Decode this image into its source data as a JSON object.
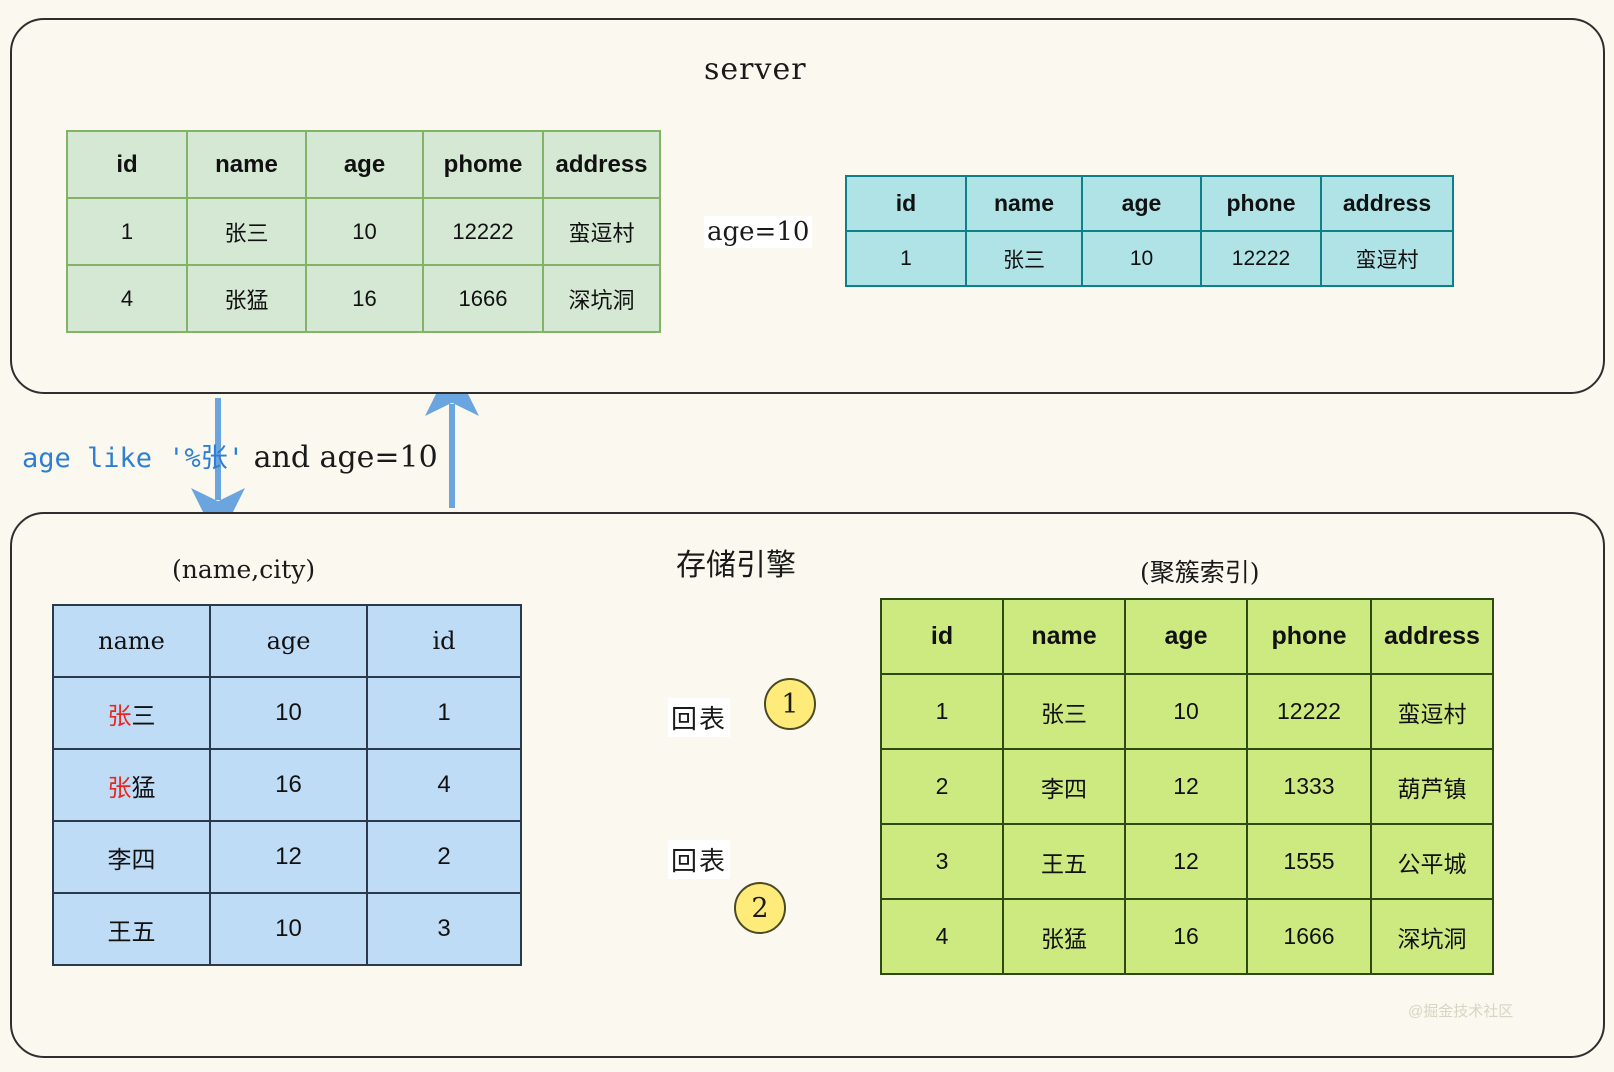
{
  "server": {
    "title": "server",
    "source_table": {
      "columns": [
        "id",
        "name",
        "age",
        "phome",
        "address"
      ],
      "rows": [
        [
          "1",
          "张三",
          "10",
          "12222",
          "蛮逗村"
        ],
        [
          "4",
          "张猛",
          "16",
          "1666",
          "深坑洞"
        ]
      ]
    },
    "result_table": {
      "columns": [
        "id",
        "name",
        "age",
        "phone",
        "address"
      ],
      "rows": [
        [
          "1",
          "张三",
          "10",
          "12222",
          "蛮逗村"
        ]
      ]
    },
    "filter_arrow_label": "age=10"
  },
  "condition": {
    "blue_text": "age like '%张'",
    "black_text": " and age=10"
  },
  "engine": {
    "title": "存储引擎",
    "index_label": "(name,city)",
    "clustered_label": "(聚簇索引)",
    "index_table": {
      "columns": [
        "name",
        "age",
        "id"
      ],
      "rows": [
        {
          "name_red": "张",
          "name_rest": "三",
          "age": "10",
          "id": "1",
          "id_red": true
        },
        {
          "name_red": "张",
          "name_rest": "猛",
          "age": "16",
          "id": "4",
          "id_red": true
        },
        {
          "name_red": "",
          "name_rest": "李四",
          "age": "12",
          "id": "2",
          "id_red": false
        },
        {
          "name_red": "",
          "name_rest": "王五",
          "age": "10",
          "id": "3",
          "id_red": false
        }
      ]
    },
    "clustered_table": {
      "columns": [
        "id",
        "name",
        "age",
        "phone",
        "address"
      ],
      "rows": [
        {
          "id": "1",
          "id_red": true,
          "name": "张三",
          "age": "10",
          "phone": "12222",
          "address": "蛮逗村"
        },
        {
          "id": "2",
          "id_red": false,
          "name": "李四",
          "age": "12",
          "phone": "1333",
          "address": "葫芦镇"
        },
        {
          "id": "3",
          "id_red": false,
          "name": "王五",
          "age": "12",
          "phone": "1555",
          "address": "公平城"
        },
        {
          "id": "4",
          "id_red": true,
          "name": "张猛",
          "age": "16",
          "phone": "1666",
          "address": "深坑洞"
        }
      ]
    },
    "lookup_label_1": "回表",
    "lookup_label_2": "回表",
    "step_1": "1",
    "step_2": "2"
  },
  "watermark": "@掘金技术社区",
  "colors": {
    "background": "#faf8ef",
    "green_fill": "#d5e8d4",
    "green_border": "#82b366",
    "cyan_fill": "#b0e3e6",
    "cyan_border": "#0e8088",
    "blue_fill": "#bfdcf7",
    "blue_border": "#2a3a4a",
    "bright_green_fill": "#cdea81",
    "bright_green_border": "#2d4a12",
    "arrow_blue": "#6ba5e0",
    "highlight_red": "#e8281e",
    "circle_yellow": "#ffeb7a"
  }
}
